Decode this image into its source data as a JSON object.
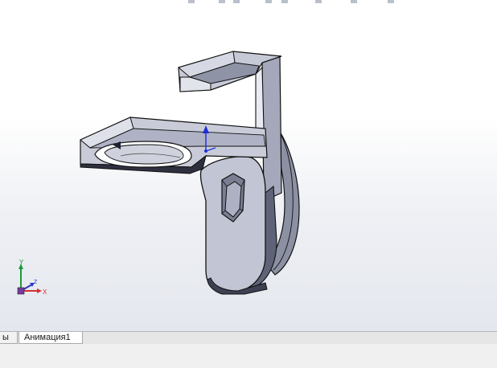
{
  "tabs": [
    {
      "label": "ы"
    },
    {
      "label": "Анимация1"
    }
  ],
  "triad": {
    "x_label": "X",
    "y_label": "Y",
    "z_label": "Z"
  },
  "colors": {
    "model_face_light": "#c9ccd8",
    "model_face_mid": "#a9adbf",
    "model_face_dark": "#6f7387",
    "edge": "#111111",
    "y_axis": "#1e9a3a",
    "x_axis": "#d43030",
    "z_axis": "#2a38c8",
    "normal_arrow": "#1f2fd6"
  }
}
